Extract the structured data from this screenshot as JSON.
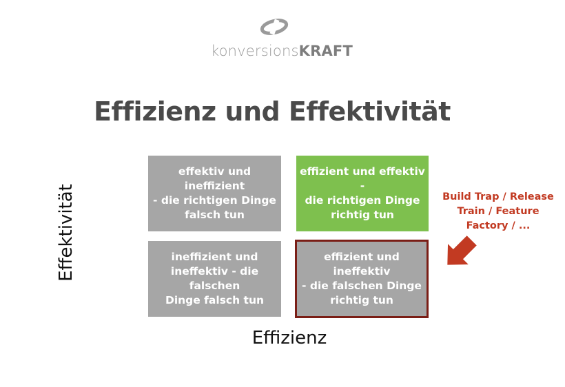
{
  "logo": {
    "text_light": "konversions",
    "text_bold": "KRAFT"
  },
  "title": "Effizienz und Effektivität",
  "axes": {
    "y": "Effektivität",
    "x": "Effizienz"
  },
  "quadrants": [
    {
      "id": "top-left",
      "text": "effektiv und ineffizient\n- die richtigen Dinge\nfalsch tun",
      "color": "#a6a6a6"
    },
    {
      "id": "top-right",
      "text": "effizient und effektiv -\ndie richtigen  Dinge\nrichtig tun",
      "color": "#7ec04e"
    },
    {
      "id": "bottom-left",
      "text": "ineffizient und\nineffektiv - die falschen\nDinge falsch tun",
      "color": "#a6a6a6"
    },
    {
      "id": "bottom-right",
      "text": "effizient und ineffektiv\n- die falschen  Dinge\nrichtig tun",
      "color": "#a6a6a6",
      "highlight": "#7a1e16"
    }
  ],
  "callout": {
    "text": "Build Trap / Release\nTrain / Feature\nFactory / ...",
    "color": "#c23a22",
    "icon": "arrow-icon"
  }
}
